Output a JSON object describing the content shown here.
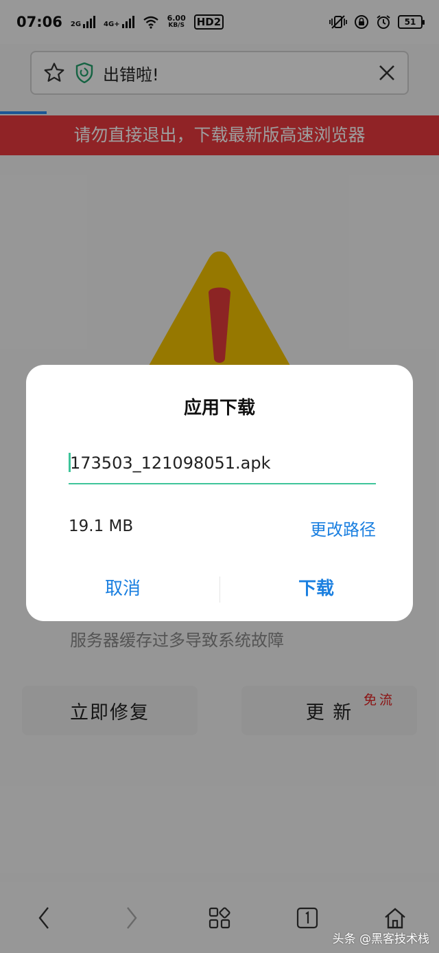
{
  "status_bar": {
    "time": "07:06",
    "sim1": "2G",
    "sim2": "4G+",
    "speed_value": "6.00",
    "speed_unit": "KB/S",
    "hd": "HD2",
    "battery": "51"
  },
  "address_bar": {
    "title": "出错啦!"
  },
  "banner": {
    "text": "请勿直接退出，下载最新版高速浏览器"
  },
  "page": {
    "error_text": "服务器缓存过多导致系统故障",
    "fix_button": "立即修复",
    "update_button": "更 新",
    "free_tag": "免流"
  },
  "dialog": {
    "title": "应用下载",
    "filename": "173503_121098051.apk",
    "size": "19.1 MB",
    "change_path": "更改路径",
    "cancel": "取消",
    "download": "下载"
  },
  "watermark": "头条 @黑客技术栈",
  "colors": {
    "accent_blue": "#1a7fe0",
    "input_underline": "#3ec49a",
    "banner_red": "#e8393e",
    "warning_yellow": "#f2c200"
  }
}
